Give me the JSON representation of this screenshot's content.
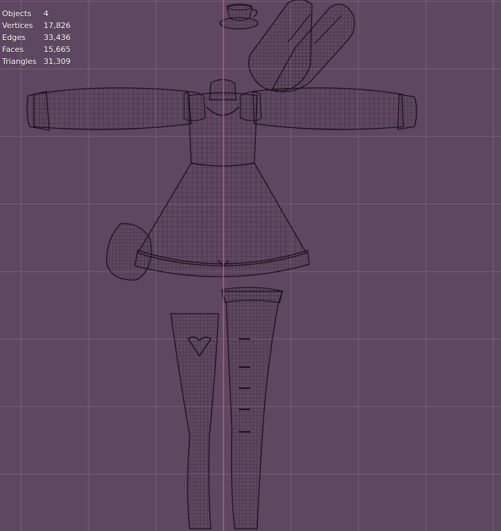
{
  "viewport": {
    "background": "#5e4760",
    "grid_color": "#7a5d7a",
    "axis_color": "#d9519b",
    "wire_color": "#1a0f1d"
  },
  "stats": [
    {
      "label": "Objects",
      "value": "4"
    },
    {
      "label": "Vertices",
      "value": "17,826"
    },
    {
      "label": "Edges",
      "value": "33,436"
    },
    {
      "label": "Faces",
      "value": "15,665"
    },
    {
      "label": "Triangles",
      "value": "31,309"
    }
  ],
  "objects": [
    "teacup-mesh",
    "bunny-ears-mesh",
    "dress-mesh",
    "stockings-mesh"
  ]
}
